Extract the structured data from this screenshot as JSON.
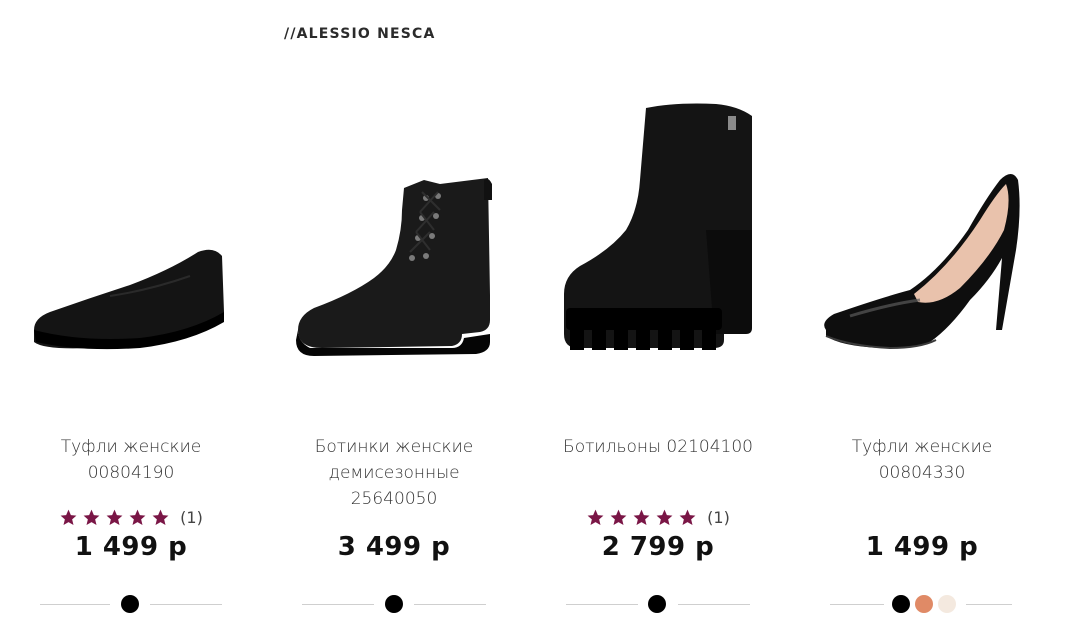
{
  "brand": {
    "logo_text": "//ALESSIO NESCA"
  },
  "products": [
    {
      "title": "Туфли женские\n00804190",
      "rating_count": "(1)",
      "stars": 5,
      "price": "1 499 р",
      "image": "black-suede-flat-shoe",
      "colors": [
        "#000000"
      ]
    },
    {
      "title": "Ботинки женские\nдемисезонные\n25640050",
      "rating_count": "",
      "stars": 0,
      "price": "3 499 р",
      "image": "black-leather-lace-up-boot",
      "colors": [
        "#000000"
      ]
    },
    {
      "title": "Ботильоны 02104100",
      "rating_count": "(1)",
      "stars": 5,
      "price": "2 799 р",
      "image": "black-suede-ankle-boot-heel",
      "colors": [
        "#000000"
      ]
    },
    {
      "title": "Туфли женские\n00804330",
      "rating_count": "",
      "stars": 0,
      "price": "1 499 р",
      "image": "black-patent-stiletto-pump",
      "colors": [
        "#000000",
        "#e08a66",
        "#f4e9df"
      ]
    }
  ],
  "colors": {
    "star": "#7a1646",
    "price": "#111111"
  }
}
